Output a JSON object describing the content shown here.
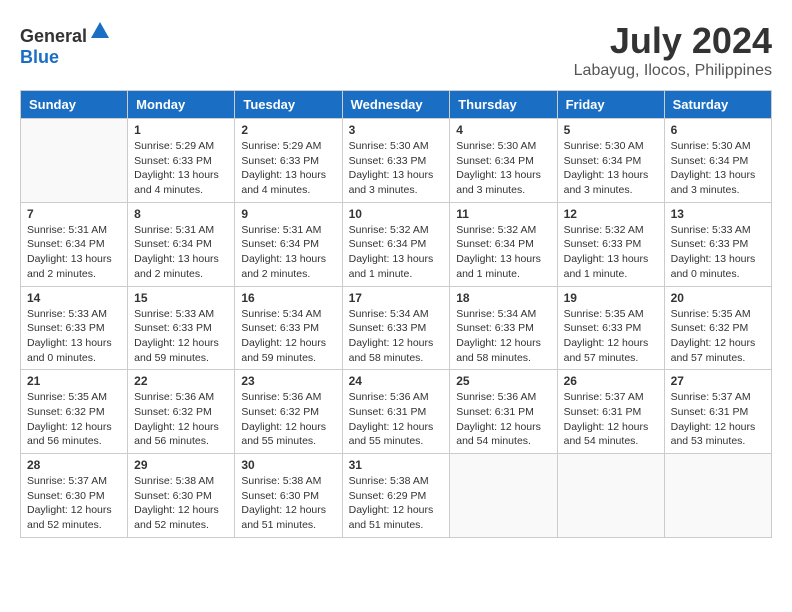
{
  "header": {
    "logo_general": "General",
    "logo_blue": "Blue",
    "month_year": "July 2024",
    "location": "Labayug, Ilocos, Philippines"
  },
  "days_of_week": [
    "Sunday",
    "Monday",
    "Tuesday",
    "Wednesday",
    "Thursday",
    "Friday",
    "Saturday"
  ],
  "weeks": [
    [
      {
        "day": "",
        "info": ""
      },
      {
        "day": "1",
        "info": "Sunrise: 5:29 AM\nSunset: 6:33 PM\nDaylight: 13 hours\nand 4 minutes."
      },
      {
        "day": "2",
        "info": "Sunrise: 5:29 AM\nSunset: 6:33 PM\nDaylight: 13 hours\nand 4 minutes."
      },
      {
        "day": "3",
        "info": "Sunrise: 5:30 AM\nSunset: 6:33 PM\nDaylight: 13 hours\nand 3 minutes."
      },
      {
        "day": "4",
        "info": "Sunrise: 5:30 AM\nSunset: 6:34 PM\nDaylight: 13 hours\nand 3 minutes."
      },
      {
        "day": "5",
        "info": "Sunrise: 5:30 AM\nSunset: 6:34 PM\nDaylight: 13 hours\nand 3 minutes."
      },
      {
        "day": "6",
        "info": "Sunrise: 5:30 AM\nSunset: 6:34 PM\nDaylight: 13 hours\nand 3 minutes."
      }
    ],
    [
      {
        "day": "7",
        "info": "Sunrise: 5:31 AM\nSunset: 6:34 PM\nDaylight: 13 hours\nand 2 minutes."
      },
      {
        "day": "8",
        "info": "Sunrise: 5:31 AM\nSunset: 6:34 PM\nDaylight: 13 hours\nand 2 minutes."
      },
      {
        "day": "9",
        "info": "Sunrise: 5:31 AM\nSunset: 6:34 PM\nDaylight: 13 hours\nand 2 minutes."
      },
      {
        "day": "10",
        "info": "Sunrise: 5:32 AM\nSunset: 6:34 PM\nDaylight: 13 hours\nand 1 minute."
      },
      {
        "day": "11",
        "info": "Sunrise: 5:32 AM\nSunset: 6:34 PM\nDaylight: 13 hours\nand 1 minute."
      },
      {
        "day": "12",
        "info": "Sunrise: 5:32 AM\nSunset: 6:33 PM\nDaylight: 13 hours\nand 1 minute."
      },
      {
        "day": "13",
        "info": "Sunrise: 5:33 AM\nSunset: 6:33 PM\nDaylight: 13 hours\nand 0 minutes."
      }
    ],
    [
      {
        "day": "14",
        "info": "Sunrise: 5:33 AM\nSunset: 6:33 PM\nDaylight: 13 hours\nand 0 minutes."
      },
      {
        "day": "15",
        "info": "Sunrise: 5:33 AM\nSunset: 6:33 PM\nDaylight: 12 hours\nand 59 minutes."
      },
      {
        "day": "16",
        "info": "Sunrise: 5:34 AM\nSunset: 6:33 PM\nDaylight: 12 hours\nand 59 minutes."
      },
      {
        "day": "17",
        "info": "Sunrise: 5:34 AM\nSunset: 6:33 PM\nDaylight: 12 hours\nand 58 minutes."
      },
      {
        "day": "18",
        "info": "Sunrise: 5:34 AM\nSunset: 6:33 PM\nDaylight: 12 hours\nand 58 minutes."
      },
      {
        "day": "19",
        "info": "Sunrise: 5:35 AM\nSunset: 6:33 PM\nDaylight: 12 hours\nand 57 minutes."
      },
      {
        "day": "20",
        "info": "Sunrise: 5:35 AM\nSunset: 6:32 PM\nDaylight: 12 hours\nand 57 minutes."
      }
    ],
    [
      {
        "day": "21",
        "info": "Sunrise: 5:35 AM\nSunset: 6:32 PM\nDaylight: 12 hours\nand 56 minutes."
      },
      {
        "day": "22",
        "info": "Sunrise: 5:36 AM\nSunset: 6:32 PM\nDaylight: 12 hours\nand 56 minutes."
      },
      {
        "day": "23",
        "info": "Sunrise: 5:36 AM\nSunset: 6:32 PM\nDaylight: 12 hours\nand 55 minutes."
      },
      {
        "day": "24",
        "info": "Sunrise: 5:36 AM\nSunset: 6:31 PM\nDaylight: 12 hours\nand 55 minutes."
      },
      {
        "day": "25",
        "info": "Sunrise: 5:36 AM\nSunset: 6:31 PM\nDaylight: 12 hours\nand 54 minutes."
      },
      {
        "day": "26",
        "info": "Sunrise: 5:37 AM\nSunset: 6:31 PM\nDaylight: 12 hours\nand 54 minutes."
      },
      {
        "day": "27",
        "info": "Sunrise: 5:37 AM\nSunset: 6:31 PM\nDaylight: 12 hours\nand 53 minutes."
      }
    ],
    [
      {
        "day": "28",
        "info": "Sunrise: 5:37 AM\nSunset: 6:30 PM\nDaylight: 12 hours\nand 52 minutes."
      },
      {
        "day": "29",
        "info": "Sunrise: 5:38 AM\nSunset: 6:30 PM\nDaylight: 12 hours\nand 52 minutes."
      },
      {
        "day": "30",
        "info": "Sunrise: 5:38 AM\nSunset: 6:30 PM\nDaylight: 12 hours\nand 51 minutes."
      },
      {
        "day": "31",
        "info": "Sunrise: 5:38 AM\nSunset: 6:29 PM\nDaylight: 12 hours\nand 51 minutes."
      },
      {
        "day": "",
        "info": ""
      },
      {
        "day": "",
        "info": ""
      },
      {
        "day": "",
        "info": ""
      }
    ]
  ]
}
